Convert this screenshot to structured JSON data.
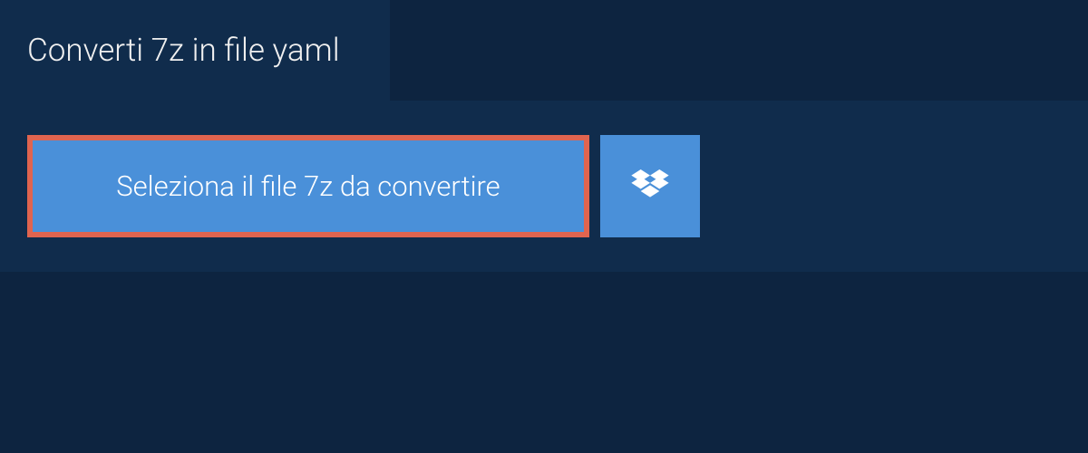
{
  "tab": {
    "title": "Converti 7z in file yaml"
  },
  "uploader": {
    "select_button_label": "Seleziona il file 7z da convertire"
  }
}
